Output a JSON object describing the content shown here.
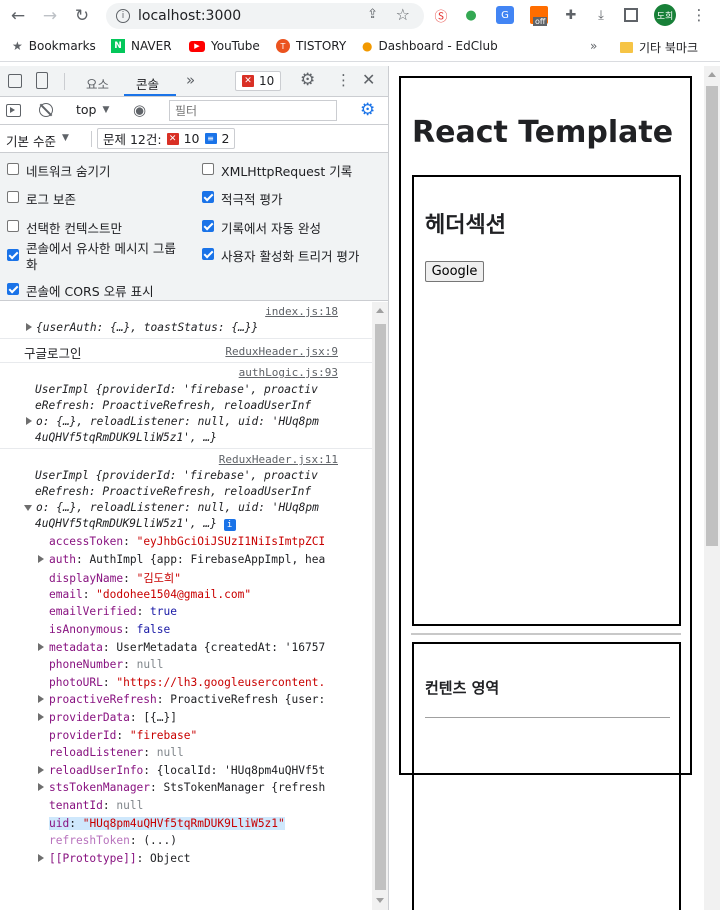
{
  "browser": {
    "url": "localhost:3000",
    "bookmarks": [
      "Bookmarks",
      "NAVER",
      "YouTube",
      "TISTORY",
      "Dashboard - EdClub"
    ],
    "other_bookmarks": "기타 북마크",
    "more": "»",
    "profile": "도희",
    "ext_badge": "off"
  },
  "devtools": {
    "tabs": [
      "요소",
      "콘솔"
    ],
    "more_tabs": "»",
    "error_count": "10",
    "context": "top",
    "filter_placeholder": "필터",
    "level": "기본 수준",
    "issues_label": "문제 12건:",
    "issues_errors": "10",
    "issues_info": "2",
    "options": [
      "네트워크 숨기기",
      "XMLHttpRequest 기록",
      "로그 보존",
      "적극적 평가",
      "선택한 컨텍스트만",
      "기록에서 자동 완성",
      "콘솔에서 유사한 메시지 그룹화",
      "사용자 활성화 트리거 평가",
      "콘솔에 CORS 오류 표시"
    ]
  },
  "console": {
    "src1": "index.js:18",
    "msg1": "{userAuth: {…}, toastStatus: {…}}",
    "msg2": "구글로그인",
    "src2": "ReduxHeader.jsx:9",
    "src3": "authLogic.js:93",
    "obj_lines": [
      "UserImpl {providerId: 'firebase', proactiv",
      "eRefresh: ProactiveRefresh, reloadUserInf",
      "o: {…}, reloadListener: null, uid: 'HUq8pm",
      "4uQHVf5tqRmDUK9LliW5z1', …}"
    ],
    "src4": "ReduxHeader.jsx:11",
    "props": [
      {
        "k": "accessToken",
        "v": "\"eyJhbGciOiJSUzI1NiIsImtpZCI"
      },
      {
        "k": "auth",
        "v": "AuthImpl {app: FirebaseAppImpl, hea"
      },
      {
        "k": "displayName",
        "v": "\"김도희\""
      },
      {
        "k": "email",
        "v": "\"dodohee1504@gmail.com\""
      },
      {
        "k": "emailVerified",
        "v": "true"
      },
      {
        "k": "isAnonymous",
        "v": "false"
      },
      {
        "k": "metadata",
        "v": "UserMetadata {createdAt: '16757"
      },
      {
        "k": "phoneNumber",
        "v": "null"
      },
      {
        "k": "photoURL",
        "v": "\"https://lh3.googleusercontent."
      },
      {
        "k": "proactiveRefresh",
        "v": "ProactiveRefresh {user:"
      },
      {
        "k": "providerData",
        "v": "[{…}]"
      },
      {
        "k": "providerId",
        "v": "\"firebase\""
      },
      {
        "k": "reloadListener",
        "v": "null"
      },
      {
        "k": "reloadUserInfo",
        "v": "{localId: 'HUq8pm4uQHVf5t"
      },
      {
        "k": "stsTokenManager",
        "v": "StsTokenManager {refresh"
      },
      {
        "k": "tenantId",
        "v": "null"
      },
      {
        "k": "uid",
        "v": "\"HUq8pm4uQHVf5tqRmDUK9LliW5z1\""
      },
      {
        "k": "refreshToken",
        "v": "(...)"
      },
      {
        "k": "[[Prototype]]",
        "v": "Object"
      }
    ],
    "prompt": "›"
  },
  "app": {
    "title": "React Template",
    "header_title": "헤더섹션",
    "google_button": "Google",
    "content_title": "컨텐츠 영역"
  },
  "colors": {
    "accent": "#1a73e8",
    "error": "#d93025",
    "string": "#c80000",
    "key": "#881280"
  }
}
